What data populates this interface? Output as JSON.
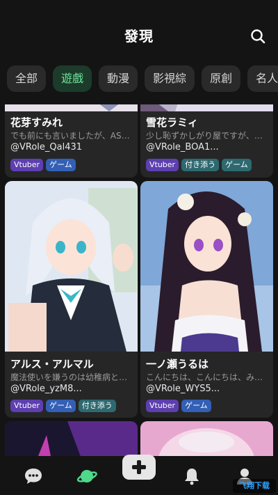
{
  "header": {
    "title": "發現"
  },
  "tabs": [
    {
      "label": "全部"
    },
    {
      "label": "遊戲"
    },
    {
      "label": "動漫"
    },
    {
      "label": "影視綜"
    },
    {
      "label": "原創"
    },
    {
      "label": "名人"
    }
  ],
  "active_tab": "遊戲",
  "cards": [
    {
      "name": "花芽すみれ",
      "description": "でも前にも言いましたが、ASMR...",
      "handle": "@VRole_Qal431",
      "tags": [
        "Vtuber",
        "ゲーム"
      ]
    },
    {
      "name": "雪花ラミィ",
      "description": "少し恥ずかしがり屋ですが、それ...",
      "handle": "@VRole_BOA1...",
      "tags": [
        "Vtuber",
        "付き添う",
        "ゲーム"
      ]
    },
    {
      "name": "アルス・アルマル",
      "description": "魔法使いを嫌うのは幼稚病という...",
      "handle": "@VRole_yzM8...",
      "tags": [
        "Vtuber",
        "ゲーム",
        "付き添う"
      ]
    },
    {
      "name": "一ノ瀬うるは",
      "description": "こんにちは、こんにちは、みんな...",
      "handle": "@VRole_WYS5...",
      "tags": [
        "Vtuber",
        "ゲーム"
      ]
    }
  ],
  "nav": {
    "items": [
      "chat-icon",
      "discover-planet-icon",
      "create-plus-icon",
      "notification-bell-icon",
      "profile-icon"
    ]
  },
  "watermark": "飞翔下载",
  "colors": {
    "background": "#141414",
    "card": "#262626",
    "accent_green": "#6fe59a",
    "tag_vtuber": "#5d3fb0",
    "tag_game": "#335fb5",
    "tag_tsukisou": "#2e6970"
  }
}
